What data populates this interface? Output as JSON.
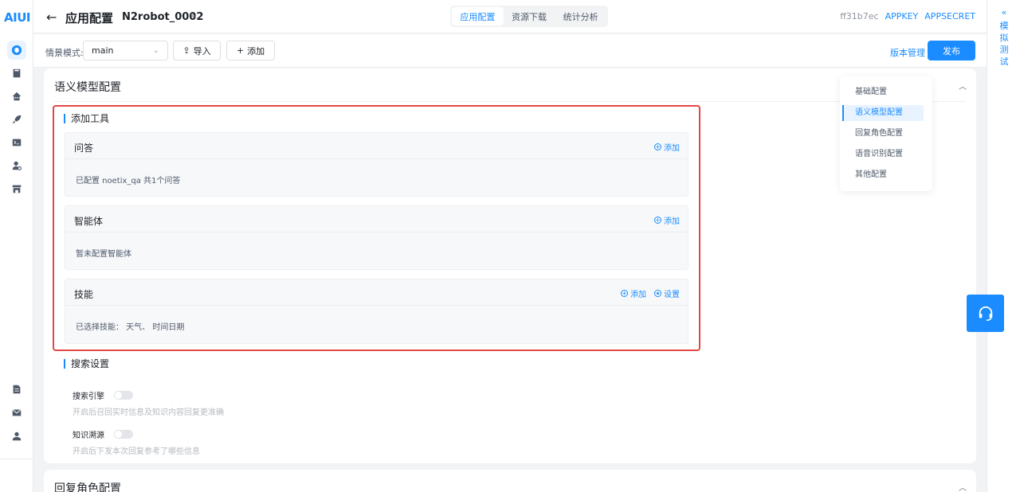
{
  "brand": {
    "logo": "AIUI",
    "accent": "#1a8cff",
    "highlight": "#e54545"
  },
  "header": {
    "back_icon": "arrow-left-icon",
    "title": "应用配置",
    "robot_name": "N2robot_0002",
    "tabs": [
      {
        "label": "应用配置",
        "active": true
      },
      {
        "label": "资源下载",
        "active": false
      },
      {
        "label": "统计分析",
        "active": false
      }
    ],
    "app_id": "ff31b7ec",
    "appkey_label": "APPKEY",
    "appsecret_label": "APPSECRET"
  },
  "toolbar": {
    "scene_label": "情景模式:",
    "scene_value": "main",
    "import_label": "导入",
    "add_label": "添加",
    "version_label": "版本管理",
    "publish_label": "发布"
  },
  "left_nav": [
    {
      "icon": "app-config-icon",
      "active": true
    },
    {
      "icon": "book-icon",
      "active": false
    },
    {
      "icon": "robot-icon",
      "active": false
    },
    {
      "icon": "rocket-icon",
      "active": false
    },
    {
      "icon": "terminal-icon",
      "active": false
    },
    {
      "icon": "user-settings-icon",
      "active": false
    },
    {
      "icon": "store-icon",
      "active": false
    },
    {
      "icon": "document-icon",
      "active": false
    },
    {
      "icon": "mail-icon",
      "active": false
    },
    {
      "icon": "user-icon",
      "active": false
    }
  ],
  "right_rail": {
    "label_chars": [
      "模",
      "拟",
      "测",
      "试"
    ]
  },
  "semantic_card": {
    "title": "语义模型配置",
    "add_tools_label": "添加工具",
    "tools": [
      {
        "name": "问答",
        "actions": [
          "添加"
        ],
        "body": "已配置 noetix_qa 共1个问答"
      },
      {
        "name": "智能体",
        "actions": [
          "添加"
        ],
        "body": "暂未配置智能体"
      },
      {
        "name": "技能",
        "actions": [
          "添加",
          "设置"
        ],
        "body": "已选择技能： 天气、 时间日期"
      }
    ],
    "search_settings_label": "搜索设置",
    "toggles": [
      {
        "label": "搜索引擎",
        "on": false,
        "desc": "开启后召回实时信息及知识内容回复更准确"
      },
      {
        "label": "知识溯源",
        "on": false,
        "desc": "开启后下发本次回复参考了哪些信息"
      }
    ]
  },
  "anchor_menu": [
    {
      "label": "基础配置",
      "active": false
    },
    {
      "label": "语义模型配置",
      "active": true
    },
    {
      "label": "回复角色配置",
      "active": false
    },
    {
      "label": "语音识别配置",
      "active": false
    },
    {
      "label": "其他配置",
      "active": false
    }
  ],
  "second_card": {
    "title": "回复角色配置"
  }
}
